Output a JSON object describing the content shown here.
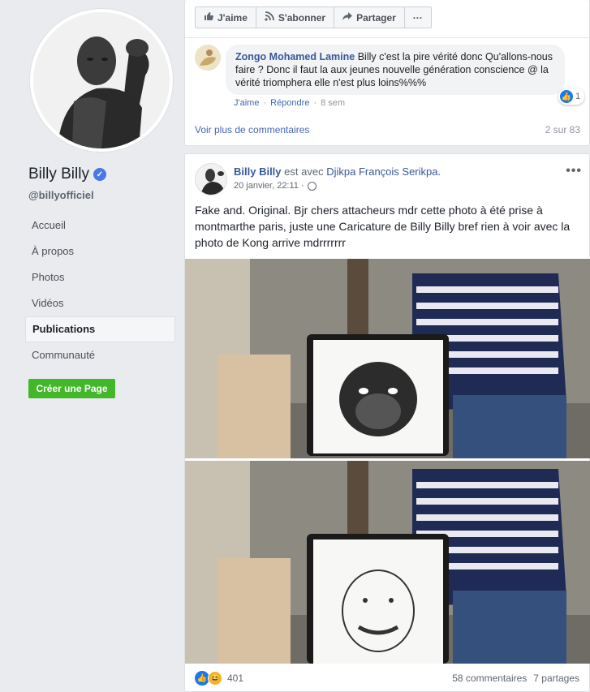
{
  "page": {
    "name": "Billy Billy",
    "handle": "@billyofficiel",
    "verified_icon": "verified-badge-icon"
  },
  "nav": {
    "items": [
      {
        "label": "Accueil"
      },
      {
        "label": "À propos"
      },
      {
        "label": "Photos"
      },
      {
        "label": "Vidéos"
      },
      {
        "label": "Publications"
      },
      {
        "label": "Communauté"
      }
    ],
    "active": "Publications"
  },
  "create_page": {
    "label": "Créer une Page"
  },
  "post1": {
    "actions": [
      {
        "label": "J'aime",
        "icon": "thumbs-up-icon"
      },
      {
        "label": "S'abonner",
        "icon": "rss-icon"
      },
      {
        "label": "Partager",
        "icon": "share-arrow-icon"
      },
      {
        "label": "···",
        "icon": "more-icon"
      }
    ],
    "comment": {
      "author": "Zongo Mohamed Lamine",
      "text": " Billy c'est la pire vérité donc Qu'allons-nous faire ? Donc il faut la aux jeunes nouvelle génération conscience @ la vérité triomphera elle n'est plus loins%%%",
      "like": "J'aime",
      "reply": "Répondre",
      "time": "8 sem",
      "reaction_count": "1"
    },
    "more_comments": "Voir plus de commentaires",
    "comment_count": "2 sur 83"
  },
  "post2": {
    "author": "Billy Billy",
    "with_text": "est avec",
    "with_name": "Djikpa François Serikpa.",
    "date": "20 janvier, 22:11 ·",
    "text": "Fake and. Original. Bjr chers attacheurs mdr cette photo à été prise à montmarthe paris, juste une Caricature de Billy Billy bref rien à voir avec la photo de Kong arrive mdrrrrrrr",
    "more": "•••",
    "reaction_count": "401",
    "comments": "58 commentaires",
    "shares": "7 partages"
  },
  "colors": {
    "link": "#385898",
    "green_button": "#42b72a",
    "like_blue": "#1877f2"
  }
}
